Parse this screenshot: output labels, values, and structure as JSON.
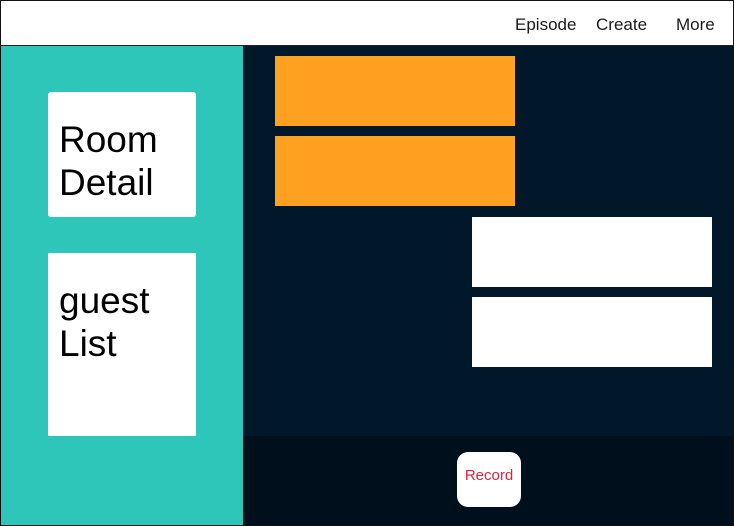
{
  "nav": {
    "episode": "Episode",
    "create": "Create",
    "more": "More"
  },
  "sidebar": {
    "room_detail": "Room\nDetail",
    "guest_list": "guest\nList"
  },
  "footer": {
    "record_label": "Record"
  },
  "colors": {
    "sidebar": "#2ec6b9",
    "stage": "#01182a",
    "orange_block": "#ffa020",
    "record_text": "#e0203c"
  }
}
